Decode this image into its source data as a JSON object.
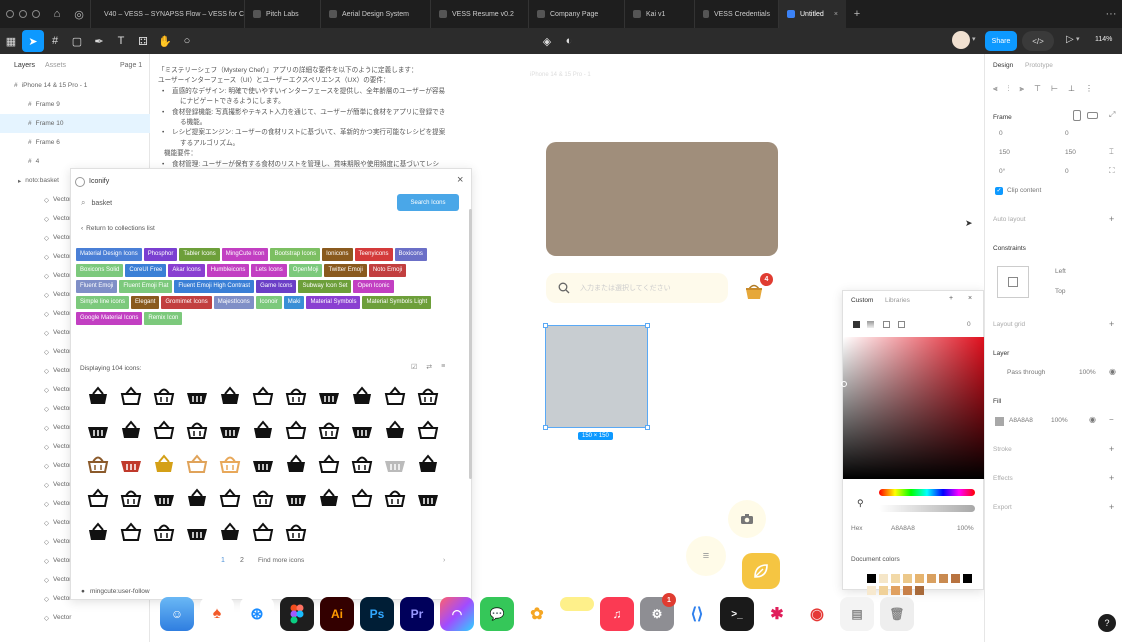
{
  "browser": {
    "tabs": [
      {
        "label": "V40 – VESS – SYNAPSS Flow – VESS for C"
      },
      {
        "label": "Pitch Labs"
      },
      {
        "label": "Aerial Design System"
      },
      {
        "label": "VESS Resume v0.2"
      },
      {
        "label": "Company Page"
      },
      {
        "label": "Kai v1"
      },
      {
        "label": "VESS Credentials"
      },
      {
        "label": "Untitled"
      }
    ]
  },
  "toolbar": {
    "share_label": "Share",
    "zoom": "114%"
  },
  "left_panel": {
    "tabs": [
      "Layers",
      "Assets"
    ],
    "page": "Page 1",
    "layers": [
      "iPhone 14 & 15 Pro - 1",
      "Frame 9",
      "Frame 10",
      "Frame 6",
      "4",
      "noto:basket",
      "Vector",
      "Vector",
      "Vector",
      "Vector",
      "Vector",
      "Vector",
      "Vector",
      "Vector",
      "Vector",
      "Vector",
      "Vector",
      "Vector",
      "Vector",
      "Vector",
      "Vector",
      "Vector",
      "Vector",
      "Vector",
      "Vector",
      "Vector",
      "Vector",
      "Vector",
      "Vector"
    ]
  },
  "doc_text": [
    "「ミステリーシェフ（Mystery Chef）」アプリの詳細な要件を以下のように定義します：",
    "ユーザーインターフェース（UI）とユーザーエクスペリエンス（UX）の要件：",
    "直感的なデザイン: 明確で使いやすいインターフェースを提供し、全年齢層のユーザーが容易",
    "にナビゲートできるようにします。",
    "食材登録機能: 写真撮影やテキスト入力を通じて、ユーザーが簡単に食材をアプリに登録でき",
    "る機能。",
    "レシピ提案エンジン: ユーザーの食材リストに基づいて、革新的かつ実行可能なレシピを提案",
    "するアルゴリズム。",
    "機能要件：",
    "食材管理: ユーザーが保有する食材のリストを管理し、賞味期限や使用頻度に基づいてレシ"
  ],
  "iconify": {
    "title": "Iconify",
    "search_value": "basket",
    "search_button": "Search Icons",
    "back_link": "Return to collections list",
    "collections": [
      {
        "label": "Material Design Icons",
        "color": "#4a7fd6"
      },
      {
        "label": "Phosphor",
        "color": "#7a3fd1"
      },
      {
        "label": "Tabler Icons",
        "color": "#6d9f3a"
      },
      {
        "label": "MingCute Icon",
        "color": "#c23fc2"
      },
      {
        "label": "Bootstrap Icons",
        "color": "#7cbf62"
      },
      {
        "label": "Ionicons",
        "color": "#8a5a1e"
      },
      {
        "label": "Teenyicons",
        "color": "#d43a3a"
      },
      {
        "label": "Boxicons",
        "color": "#6b6fc7"
      },
      {
        "label": "Boxicons Solid",
        "color": "#7cc97c"
      },
      {
        "label": "CoreUI Free",
        "color": "#3a7fd6"
      },
      {
        "label": "Akar Icons",
        "color": "#8a3fd1"
      },
      {
        "label": "Humbleicons",
        "color": "#c23fc2"
      },
      {
        "label": "Lets Icons",
        "color": "#c23fc2"
      },
      {
        "label": "OpenMoji",
        "color": "#7cc97c"
      },
      {
        "label": "Twitter Emoji",
        "color": "#8a5a1e"
      },
      {
        "label": "Noto Emoji",
        "color": "#c23f3f"
      },
      {
        "label": "Fluent Emoji",
        "color": "#7f8fc7"
      },
      {
        "label": "Fluent Emoji Flat",
        "color": "#7cc97c"
      },
      {
        "label": "Fluent Emoji High Contrast",
        "color": "#3a7fd6"
      },
      {
        "label": "Game Icons",
        "color": "#6b3fc7"
      },
      {
        "label": "Subway Icon Set",
        "color": "#6d9f3a"
      },
      {
        "label": "Open Iconic",
        "color": "#c23fc2"
      },
      {
        "label": "Simple line icons",
        "color": "#7cc97c"
      },
      {
        "label": "Elegant",
        "color": "#8a5a1e"
      },
      {
        "label": "Gromimet Icons",
        "color": "#c23f3f"
      },
      {
        "label": "MajestIcons",
        "color": "#7f8fc7"
      },
      {
        "label": "Iconoir",
        "color": "#7cc97c"
      },
      {
        "label": "Maki",
        "color": "#3a8fd6"
      },
      {
        "label": "Material Symbols",
        "color": "#8a3fd1"
      },
      {
        "label": "Material Symbols Light",
        "color": "#6d9f3a"
      },
      {
        "label": "Google Material Icons",
        "color": "#c23fc2"
      },
      {
        "label": "Remix Icon",
        "color": "#7cc97c"
      }
    ],
    "display_count": "Displaying 104 icons:",
    "pages": [
      "1",
      "2"
    ],
    "more_link": "Find more icons",
    "footer_user": "mingcute:user-follow"
  },
  "canvas": {
    "frame_label": "iPhone 14 & 15 Pro - 1",
    "search_placeholder": "入力または選択してください",
    "badge": "4",
    "size_label": "150 × 150"
  },
  "color_picker": {
    "tabs": [
      "Custom",
      "Libraries"
    ],
    "opacity_value": "0",
    "hex_label": "Hex",
    "hex_value": "A8A8A8",
    "opacity": "100%",
    "doc_colors_label": "Document colors",
    "doc_colors": [
      "#000000",
      "#f5e6c8",
      "#f2d9a8",
      "#ecc88a",
      "#e6b46f",
      "#d9a060",
      "#c98a50",
      "#b87340",
      "#000000",
      "#f7e9cf",
      "#f0d199",
      "#e0a060",
      "#c88048",
      "#a86a3a"
    ]
  },
  "right_panel": {
    "tabs": [
      "Design",
      "Prototype"
    ],
    "frame_label": "Frame",
    "x": "0",
    "y": "0",
    "w": "150",
    "h": "150",
    "rotation": "0°",
    "radius": "0",
    "clip_content": "Clip content",
    "auto_layout": "Auto layout",
    "constraints": "Constraints",
    "constraint_h": "Left",
    "constraint_v": "Top",
    "layout_grid": "Layout grid",
    "layer": "Layer",
    "pass_through": "Pass through",
    "layer_opacity": "100%",
    "fill": "Fill",
    "fill_hex": "A8A8A8",
    "fill_opacity": "100%",
    "stroke": "Stroke",
    "effects": "Effects",
    "export": "Export"
  },
  "dock": {
    "ai": "Ai",
    "ps": "Ps",
    "pr": "Pr",
    "badge": "1"
  },
  "help": "?"
}
